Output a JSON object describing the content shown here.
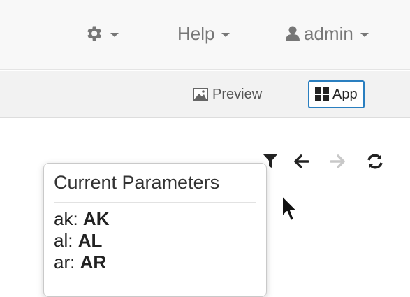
{
  "navbar": {
    "settings_icon": "gear-icon",
    "help_label": "Help",
    "user_icon": "user-icon",
    "user_label": "admin"
  },
  "mode_switch": {
    "preview_label": "Preview",
    "preview_icon": "image-icon",
    "app_label": "App",
    "app_icon": "grid-icon",
    "active": "App",
    "active_color": "#2a7fc0"
  },
  "toolbar": {
    "icons": [
      "filter-icon",
      "back-arrow-icon",
      "forward-arrow-icon",
      "refresh-icon"
    ]
  },
  "popover": {
    "title": "Current Parameters",
    "params": [
      {
        "key": "ak",
        "value": "AK"
      },
      {
        "key": "al",
        "value": "AL"
      },
      {
        "key": "ar",
        "value": "AR"
      }
    ]
  }
}
